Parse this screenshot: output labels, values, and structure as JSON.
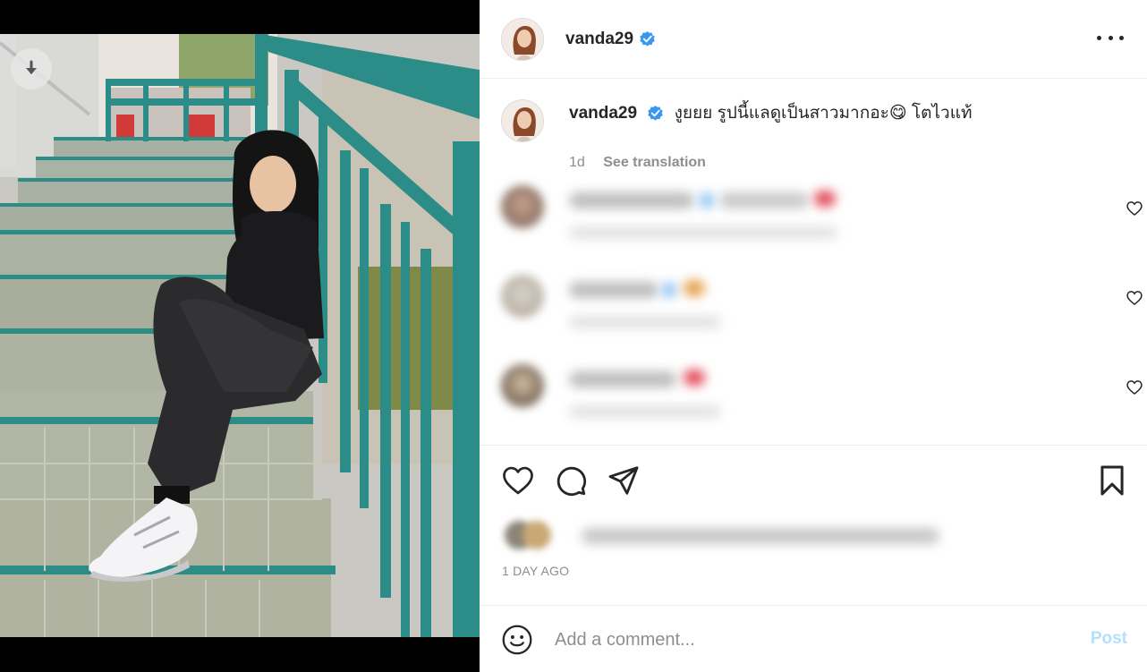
{
  "post": {
    "author": "vanda29",
    "verified": true,
    "caption_user": "vanda29",
    "caption_text": "งูยยย รูปนี้แลดูเป็นสาวมากอะ😋 โตไวแท้",
    "caption_age": "1d",
    "see_translation": "See translation",
    "timestamp": "1 DAY AGO"
  },
  "comment_box": {
    "placeholder": "Add a comment...",
    "post_label": "Post"
  },
  "icons": {
    "more": "more-options-icon",
    "like": "heart-icon",
    "comment": "comment-icon",
    "share": "share-icon",
    "save": "bookmark-icon",
    "emoji": "emoji-icon",
    "download": "download-icon",
    "verified": "verified-badge-icon"
  },
  "colors": {
    "verified_blue": "#3897f0",
    "post_disabled": "#b2dffc",
    "muted_text": "#8e8e8e",
    "photo_rail_teal": "#2a8c88"
  }
}
